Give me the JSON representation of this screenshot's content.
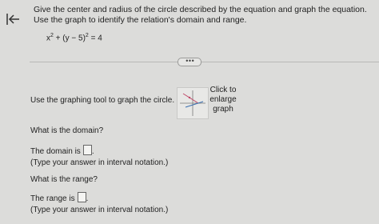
{
  "question": {
    "prompt": "Give the center and radius of the circle described by the equation and graph the equation. Use the graph to identify the relation's domain and range.",
    "equation": {
      "base1": "x",
      "exp1": "2",
      "middle": " + (y − 5)",
      "exp2": "2",
      "tail": " = 4"
    }
  },
  "more_button_label": "• • •",
  "graph_section": {
    "instruction": "Use the graphing tool to graph the circle.",
    "enlarge_label": "Click to enlarge graph"
  },
  "domain_q": {
    "question": "What is the domain?",
    "answer_label": "The domain is",
    "answer_value": "",
    "period": ".",
    "hint": "(Type your answer in interval notation.)"
  },
  "range_q": {
    "question": "What is the range?",
    "answer_label": "The range is",
    "answer_value": "",
    "period": ".",
    "hint": "(Type your answer in interval notation.)"
  },
  "icons": {
    "back": "back-to-start-arrow-icon",
    "thumbnail": "graph-thumbnail-icon"
  },
  "colors": {
    "thumbnail_line_pink": "#c04a6a",
    "thumbnail_line_blue": "#3a6fb0"
  }
}
